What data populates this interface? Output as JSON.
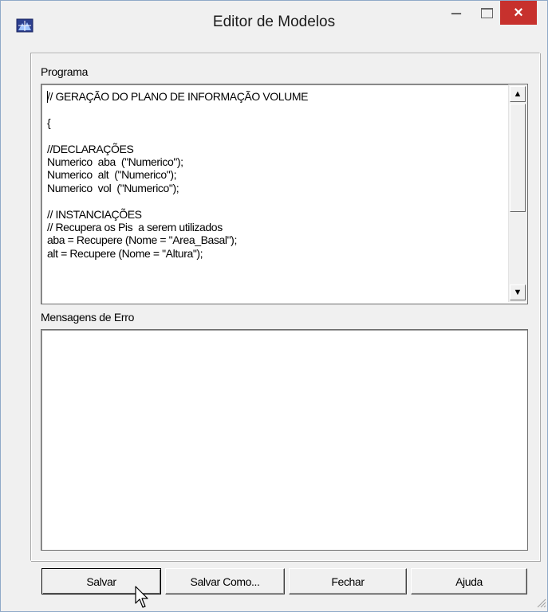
{
  "window": {
    "title": "Editor de Modelos",
    "minimize_glyph": "–",
    "close_glyph": "×"
  },
  "program": {
    "label": "Programa",
    "code": "// GERAÇÃO DO PLANO DE INFORMAÇÃO VOLUME\n\n{\n\n//DECLARAÇÕES\nNumerico  aba  (\"Numerico\");\nNumerico  alt  (\"Numerico\");\nNumerico  vol  (\"Numerico\");\n\n// INSTANCIAÇÕES\n// Recupera os Pis  a serem utilizados\naba = Recupere (Nome = \"Area_Basal\");\nalt = Recupere (Nome = \"Altura\");"
  },
  "errors": {
    "label": "Mensagens de Erro",
    "text": ""
  },
  "buttons": {
    "save": "Salvar",
    "save_as": "Salvar Como...",
    "close": "Fechar",
    "help": "Ajuda"
  },
  "icons": {
    "app": "model-editor-icon",
    "scroll_up": "arrow-up-icon",
    "scroll_down": "arrow-down-icon",
    "cursor": "mouse-pointer-icon"
  },
  "colors": {
    "close_button": "#c7312d",
    "window_bg": "#f0f0f0"
  }
}
